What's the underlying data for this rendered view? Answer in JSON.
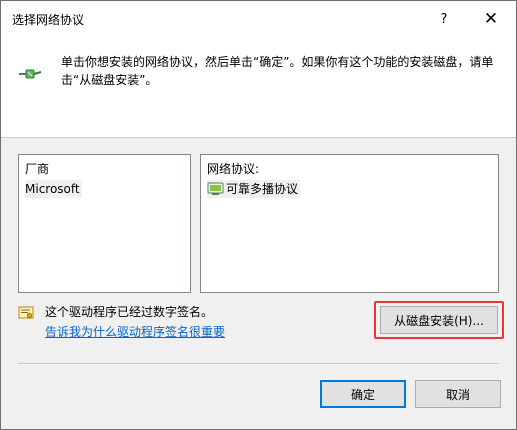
{
  "window": {
    "title": "选择网络协议",
    "help_glyph": "?",
    "close_glyph": "✕"
  },
  "header": {
    "instructions": "单击你想安装的网络协议，然后单击“确定”。如果你有这个功能的安装磁盘，请单击“从磁盘安装”。",
    "icon": "network-cable-icon"
  },
  "manufacturer_list": {
    "header": "厂商",
    "items": [
      "Microsoft"
    ]
  },
  "protocol_list": {
    "header": "网络协议:",
    "items": [
      {
        "icon": "protocol-icon",
        "label": "可靠多播协议"
      }
    ]
  },
  "signature": {
    "icon": "signed-driver-icon",
    "status_text": "这个驱动程序已经过数字签名。",
    "link_text": "告诉我为什么驱动程序签名很重要"
  },
  "buttons": {
    "have_disk": "从磁盘安装(H)...",
    "ok": "确定",
    "cancel": "取消"
  },
  "colors": {
    "highlight_border": "#e53935",
    "link": "#0066cc",
    "default_button_border": "#0078d7"
  }
}
